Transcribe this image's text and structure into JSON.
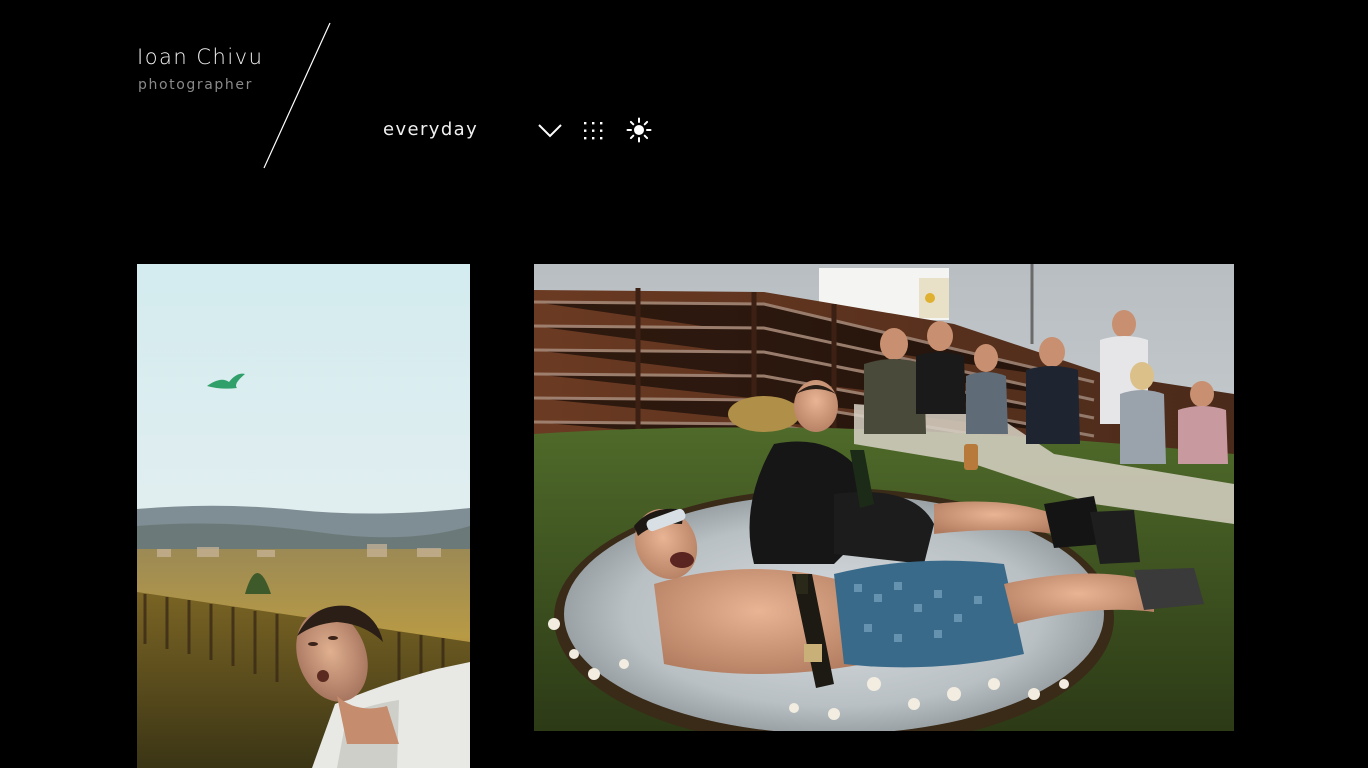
{
  "brand": {
    "name": "Ioan Chivu",
    "tagline": "photographer"
  },
  "nav": {
    "gallery_label": "everyday",
    "icons": [
      "chevron-down-icon",
      "grid-icon",
      "sun-icon"
    ]
  },
  "colors": {
    "background": "#000000",
    "text": "#f2f2f2",
    "muted_text": "#8a8a8a"
  },
  "photos": [
    {
      "subject": "man-catching-green-object-outdoors"
    },
    {
      "subject": "man-in-ice-bath-with-bottle-and-crowd"
    }
  ]
}
